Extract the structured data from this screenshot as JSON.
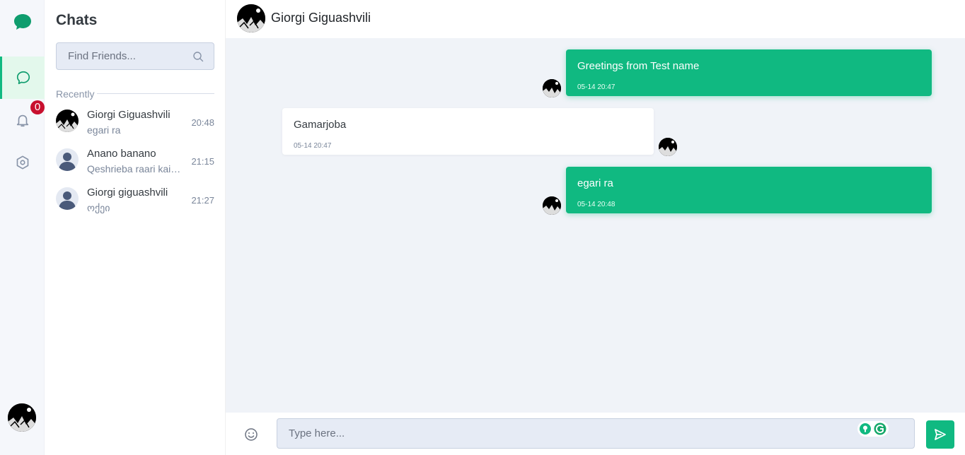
{
  "theme": {
    "accent": "#10b981",
    "badge": "#c8102e",
    "rail_bg": "#f5f7fb",
    "convo_bg": "#f0f3f8"
  },
  "rail": {
    "logo_icon": "chat-bubble-logo",
    "items": [
      {
        "icon": "chat-icon",
        "active": true
      },
      {
        "icon": "bell-icon",
        "badge": "0"
      },
      {
        "icon": "settings-hexagon-icon"
      }
    ]
  },
  "chats": {
    "title": "Chats",
    "search_placeholder": "Find Friends...",
    "recent_label": "Recently",
    "items": [
      {
        "name": "Giorgi Giguashvili",
        "preview": "egari ra",
        "time": "20:48",
        "avatar": "photo"
      },
      {
        "name": "Anano banano",
        "preview": "Qeshrieba raari kaia...",
        "time": "21:15",
        "avatar": "default-user"
      },
      {
        "name": "Giorgi giguashvili",
        "preview": "ოქეი",
        "time": "21:27",
        "avatar": "default-user"
      }
    ]
  },
  "conversation": {
    "title": "Giorgi Giguashvili",
    "messages": [
      {
        "direction": "out",
        "text": "Greetings from Test name",
        "time": "05-14 20:47"
      },
      {
        "direction": "in",
        "text": "Gamarjoba",
        "time": "05-14 20:47"
      },
      {
        "direction": "out",
        "text": "egari ra",
        "time": "05-14 20:48"
      }
    ]
  },
  "composer": {
    "placeholder": "Type here...",
    "emoji_icon": "smile-icon",
    "send_icon": "send-icon"
  }
}
